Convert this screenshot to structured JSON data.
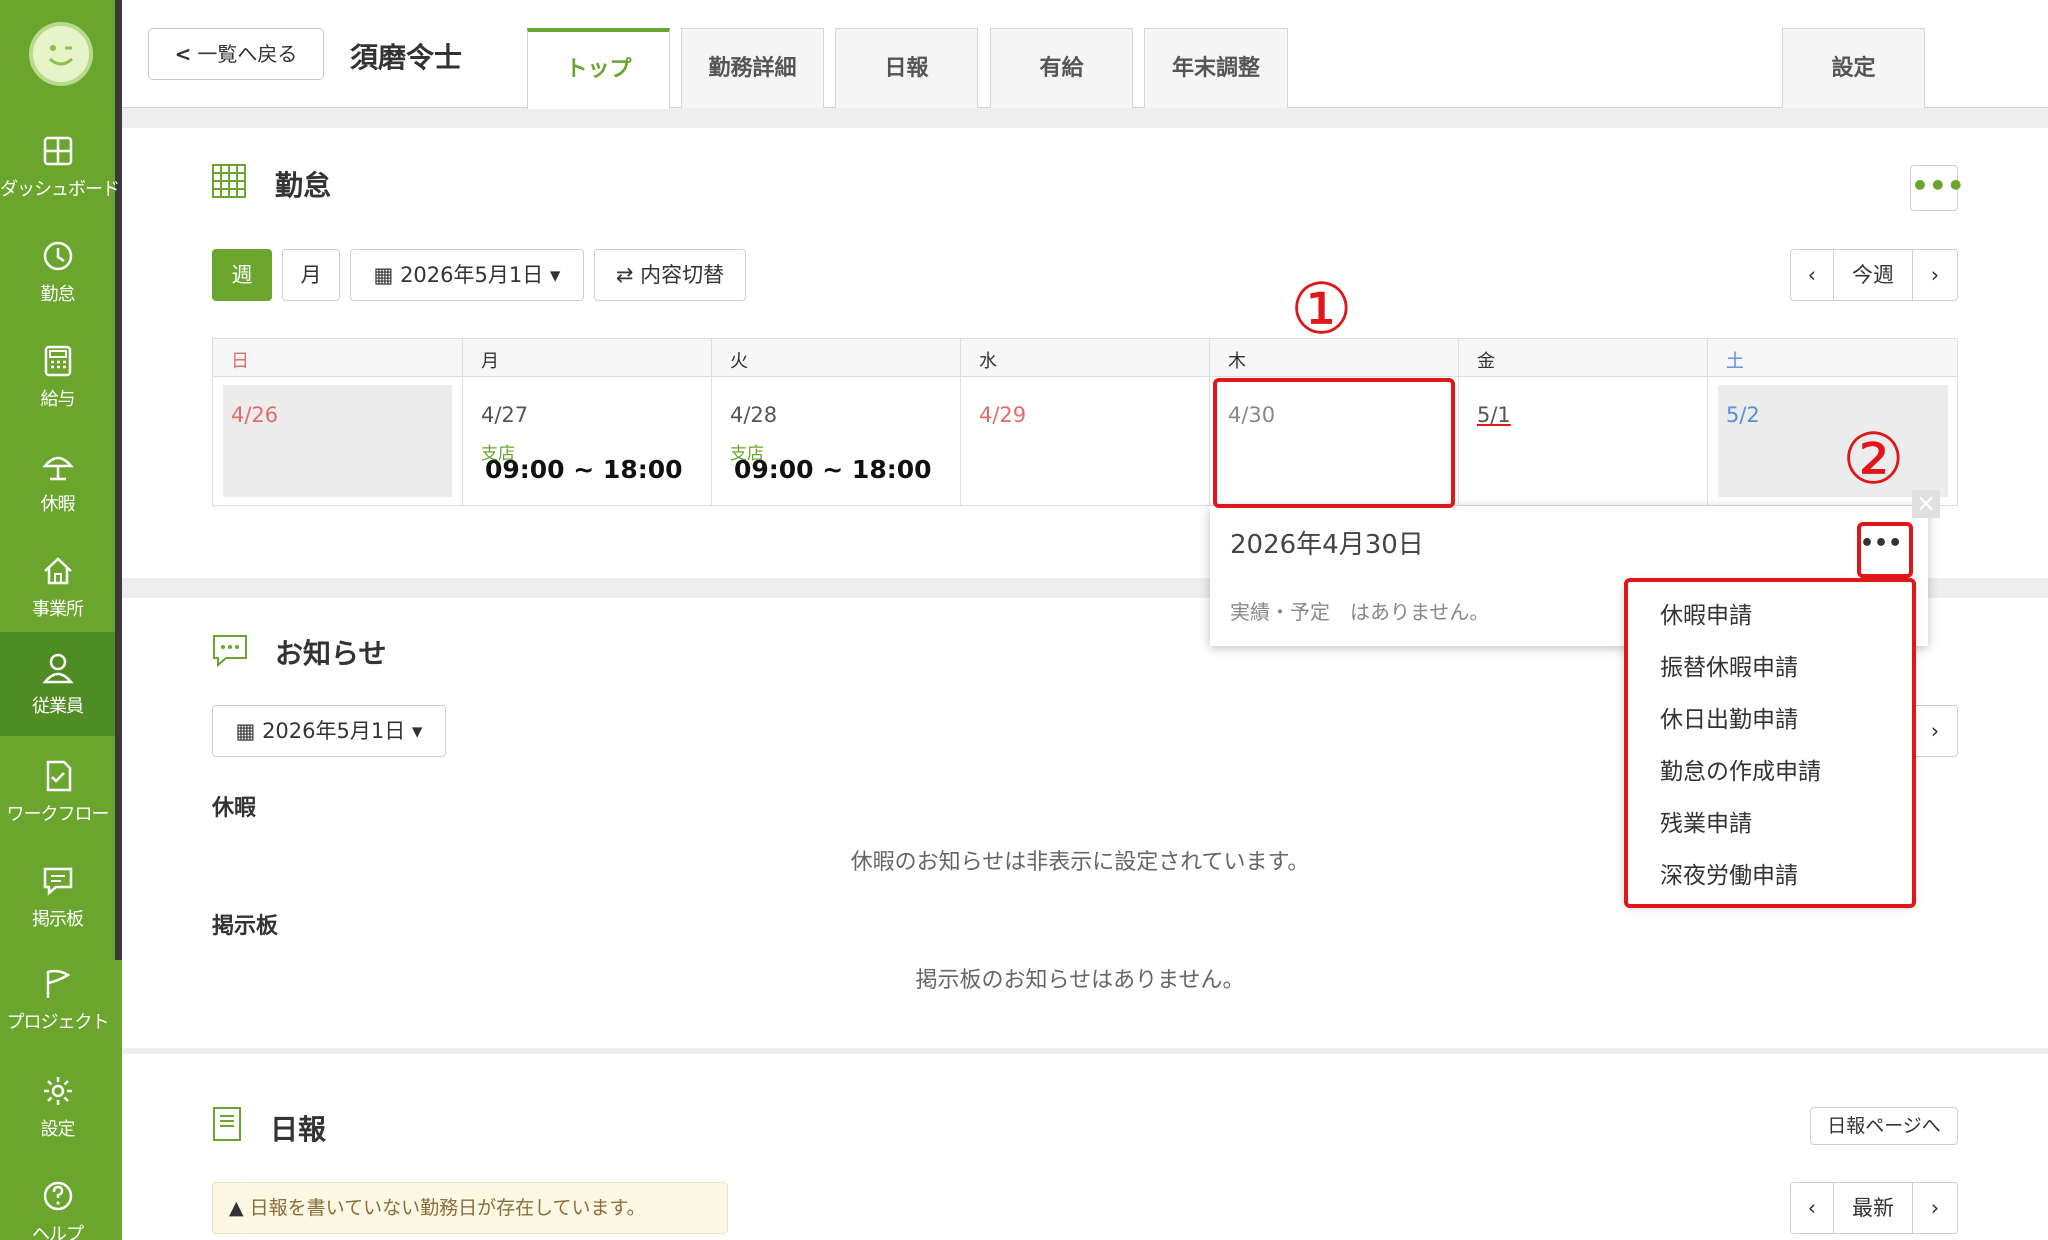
{
  "sidebar": {
    "items": [
      {
        "label": "ダッシュボード",
        "icon": "dashboard-icon"
      },
      {
        "label": "勤怠",
        "icon": "clock-icon"
      },
      {
        "label": "給与",
        "icon": "calculator-icon"
      },
      {
        "label": "休暇",
        "icon": "umbrella-icon"
      },
      {
        "label": "事業所",
        "icon": "home-icon"
      },
      {
        "label": "従業員",
        "icon": "person-icon"
      },
      {
        "label": "ワークフロー",
        "icon": "checklist-icon"
      },
      {
        "label": "掲示板",
        "icon": "chat-icon"
      },
      {
        "label": "プロジェクト",
        "icon": "flag-icon"
      },
      {
        "label": "設定",
        "icon": "gear-icon"
      },
      {
        "label": "ヘルプ",
        "icon": "help-icon"
      }
    ],
    "active": "従業員"
  },
  "header": {
    "back_label": "一覧へ戻る",
    "employee_name": "須磨令士",
    "tabs": [
      "トップ",
      "勤務詳細",
      "日報",
      "有給",
      "年末調整"
    ],
    "active_tab": "トップ",
    "settings_tab": "設定"
  },
  "attendance": {
    "title": "勤怠",
    "week_label": "週",
    "month_label": "月",
    "date_picker": "2026年5月1日",
    "toggle_label": "内容切替",
    "nav_prev": "‹",
    "nav_current": "今週",
    "nav_next": "›",
    "weekdays": [
      "日",
      "月",
      "火",
      "水",
      "木",
      "金",
      "土"
    ],
    "days": [
      {
        "date": "4/26",
        "branch": "",
        "time": ""
      },
      {
        "date": "4/27",
        "branch": "支店",
        "time": "09:00 ~ 18:00"
      },
      {
        "date": "4/28",
        "branch": "支店",
        "time": "09:00 ~ 18:00"
      },
      {
        "date": "4/29",
        "branch": "",
        "time": ""
      },
      {
        "date": "4/30",
        "branch": "",
        "time": ""
      },
      {
        "date": "5/1",
        "branch": "",
        "time": ""
      },
      {
        "date": "5/2",
        "branch": "",
        "time": ""
      }
    ]
  },
  "popover": {
    "date_title": "2026年4月30日",
    "empty_text": "実績・予定　はありません。",
    "close": "×",
    "menu_items": [
      "休暇申請",
      "振替休暇申請",
      "休日出勤申請",
      "勤怠の作成申請",
      "残業申請",
      "深夜労働申請"
    ]
  },
  "annotations": {
    "one": "①",
    "two": "②"
  },
  "notices": {
    "title": "お知らせ",
    "date_picker": "2026年5月1日",
    "nav_next": "›",
    "leave_heading": "休暇",
    "leave_text": "休暇のお知らせは非表示に設定されています。",
    "board_heading": "掲示板",
    "board_text": "掲示板のお知らせはありません。"
  },
  "daily_report": {
    "title": "日報",
    "page_button": "日報ページへ",
    "warning": "日報を書いていない勤務日が存在しています。",
    "nav_prev": "‹",
    "nav_current": "最新",
    "nav_next": "›"
  },
  "colors": {
    "brand": "#6aa52d",
    "brand_dark": "#4f8c23",
    "highlight": "#e0161b",
    "holiday": "#e06c6c",
    "saturday": "#5b8fd6"
  }
}
